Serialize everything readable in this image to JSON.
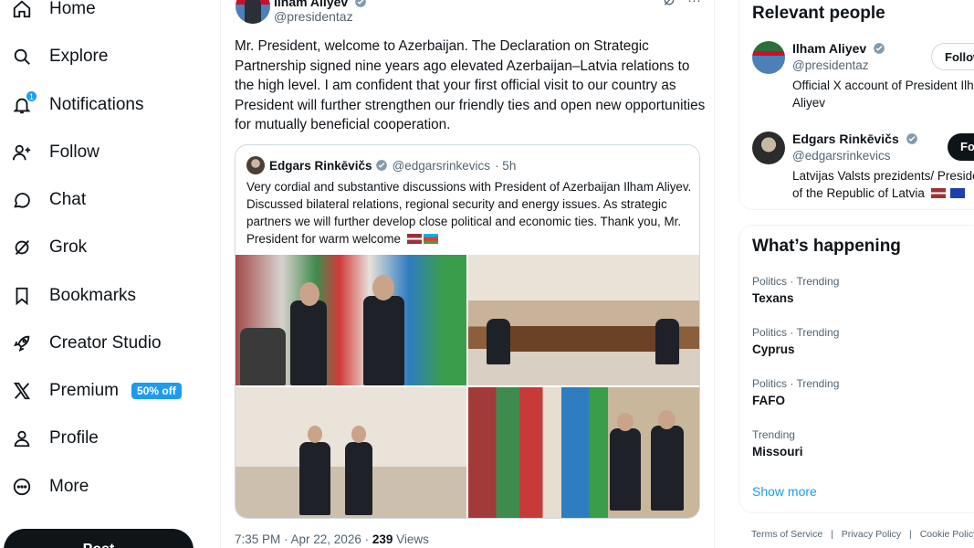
{
  "nav": {
    "items": [
      {
        "label": "Home",
        "icon": "home-icon"
      },
      {
        "label": "Explore",
        "icon": "search-icon"
      },
      {
        "label": "Notifications",
        "icon": "bell-icon",
        "badge": "1"
      },
      {
        "label": "Follow",
        "icon": "person-plus-icon"
      },
      {
        "label": "Chat",
        "icon": "chat-bubble-icon"
      },
      {
        "label": "Grok",
        "icon": "grok-icon"
      },
      {
        "label": "Bookmarks",
        "icon": "bookmark-icon"
      },
      {
        "label": "Creator Studio",
        "icon": "rocket-icon"
      },
      {
        "label": "Premium",
        "icon": "x-logo-icon",
        "promo": "50% off"
      },
      {
        "label": "Profile",
        "icon": "person-icon"
      },
      {
        "label": "More",
        "icon": "more-circle-icon"
      }
    ],
    "post_button": "Post"
  },
  "tweet": {
    "author_name": "Ilham Aliyev",
    "author_handle": "@presidentaz",
    "text": "Mr. President, welcome to Azerbaijan. The Declaration on Strategic Partnership signed nine years ago elevated Azerbaijan–Latvia relations to the high level. I am confident that your first official visit to our country as President will further strengthen our friendly ties and open new opportunities for mutually beneficial cooperation.",
    "quote": {
      "name": "Edgars Rinkēvičs",
      "handle": "@edgarsrinkevics",
      "time": "· 5h",
      "text": "Very cordial and substantive discussions with President of Azerbaijan Ilham Aliyev. Discussed bilateral relations, regional security and energy issues. As strategic partners we will further develop close political and economic ties. Thank you, Mr. President for warm welcome"
    },
    "timestamp": "7:35 PM · Apr 22, 2026 ·",
    "views_count": "239",
    "views_label": "Views"
  },
  "relevant_people": {
    "title": "Relevant people",
    "people": [
      {
        "name": "Ilham Aliyev",
        "handle": "@presidentaz",
        "bio": "Official X account of President Ilham Aliyev",
        "button": "Follow"
      },
      {
        "name": "Edgars Rinkēvičs",
        "handle": "@edgarsrinkevics",
        "bio": "Latvijas Valsts prezidents/ President of the Republic of Latvia",
        "button": "Follow"
      }
    ]
  },
  "trends": {
    "title": "What’s happening",
    "items": [
      {
        "category": "Politics · Trending",
        "name": "Texans"
      },
      {
        "category": "Politics · Trending",
        "name": "Cyprus"
      },
      {
        "category": "Politics · Trending",
        "name": "FAFO"
      },
      {
        "category": "Trending",
        "name": "Missouri"
      }
    ],
    "show_more": "Show more"
  },
  "footer": {
    "links": [
      "Terms of Service",
      "|",
      "Privacy Policy",
      "|",
      "Cookie Policy"
    ]
  },
  "colors": {
    "accent": "#1d9bf0",
    "text": "#0f1419",
    "secondary_text": "#536471",
    "border": "#cfd9de"
  }
}
